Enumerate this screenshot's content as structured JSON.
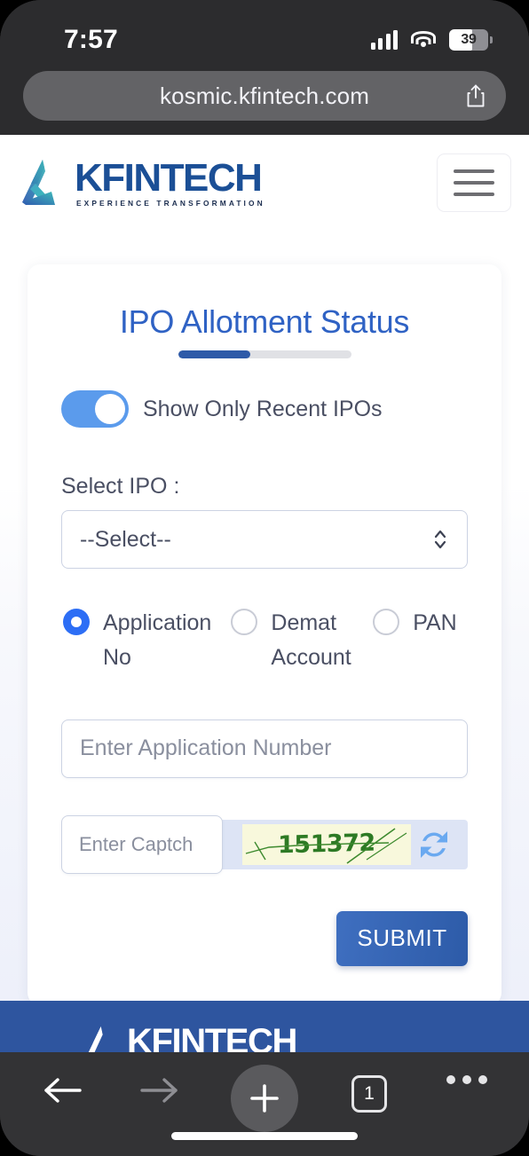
{
  "status_bar": {
    "time": "7:57",
    "signal_icon": "cellular-signal-icon",
    "wifi_icon": "wifi-icon",
    "battery_level": "39"
  },
  "browser": {
    "url": "kosmic.kfintech.com",
    "share_icon": "share-icon",
    "toolbar": {
      "back_icon": "back-arrow-icon",
      "forward_icon": "forward-arrow-icon",
      "add_icon": "plus-icon",
      "tab_count": "1",
      "more_icon": "more-ellipsis-icon"
    }
  },
  "site_header": {
    "logo_word": "KFINTECH",
    "logo_tagline": "EXPERIENCE TRANSFORMATION",
    "logo_mark_icon": "kfintech-triangle-logo-icon",
    "menu_icon": "hamburger-menu-icon"
  },
  "form": {
    "title": "IPO Allotment Status",
    "toggle": {
      "label": "Show Only Recent IPOs",
      "state": "on"
    },
    "select_ipo": {
      "label": "Select IPO :",
      "value": "--Select--",
      "caret_icon": "chevron-updown-icon"
    },
    "search_by": {
      "options": [
        "Application No",
        "Demat Account",
        "PAN"
      ],
      "selected": "Application No"
    },
    "application_number": {
      "value": "",
      "placeholder": "Enter Application Number"
    },
    "captcha": {
      "placeholder": "Enter Captch",
      "value": "",
      "image_text": "151372",
      "refresh_icon": "refresh-icon"
    },
    "submit_label": "SUBMIT"
  },
  "footer": {
    "logo_word": "KFINTECH",
    "logo_mark_icon": "kfintech-triangle-logo-icon"
  },
  "colors": {
    "brand_blue": "#1b4f96",
    "title_blue": "#2f62c4",
    "accent_blue": "#2d6ef5",
    "toggle_blue": "#5b9bec",
    "footer_blue": "#2e559f",
    "captcha_green": "#2d7a24",
    "captcha_bg": "#f8f8dc"
  }
}
